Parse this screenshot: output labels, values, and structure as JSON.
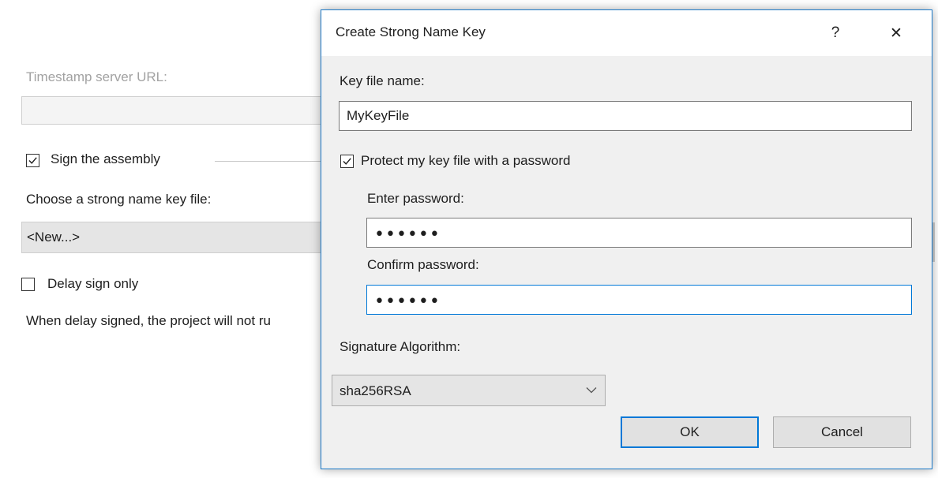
{
  "background": {
    "timestamp_label": "Timestamp server URL:",
    "timestamp_value": "",
    "sign_assembly_label": "Sign the assembly",
    "sign_assembly_checked": true,
    "key_file_label": "Choose a strong name key file:",
    "key_file_value": "<New...>",
    "delay_sign_label": "Delay sign only",
    "delay_sign_checked": false,
    "delay_note": "When delay signed, the project will not ru"
  },
  "dialog": {
    "title": "Create Strong Name Key",
    "help_glyph": "?",
    "close_glyph": "✕",
    "key_file_name_label": "Key file name:",
    "key_file_name_value": "MyKeyFile",
    "protect_label": "Protect my key file with a password",
    "protect_checked": true,
    "enter_password_label": "Enter password:",
    "enter_password_value": "••••••",
    "confirm_password_label": "Confirm password:",
    "confirm_password_value": "••••••",
    "signature_algorithm_label": "Signature Algorithm:",
    "signature_algorithm_value": "sha256RSA",
    "ok_label": "OK",
    "cancel_label": "Cancel"
  },
  "colors": {
    "accent": "#0078d7",
    "dialog_bg": "#f0f0f0",
    "disabled_text": "#a2a2a2"
  },
  "icons": {
    "checkbox_check": "check-icon",
    "dropdown": "chevron-down-icon",
    "close": "close-icon",
    "help": "help-icon"
  }
}
